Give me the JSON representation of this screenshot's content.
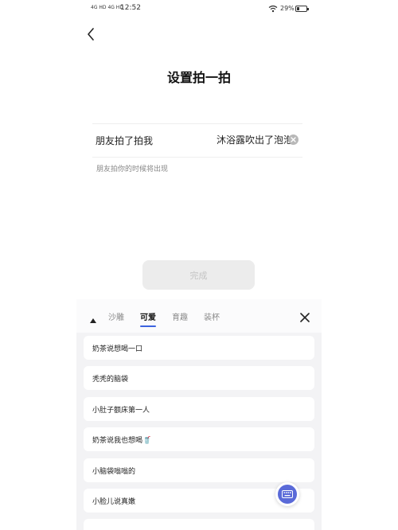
{
  "status_bar": {
    "signal_1": "4G HD",
    "signal_2": "4G HD",
    "time": "12:52",
    "battery_text": "29%",
    "battery_level": 0.29,
    "wifi_icon": "wifi-icon",
    "battery_icon": "battery-icon"
  },
  "nav": {
    "back_icon": "chevron-left-icon"
  },
  "page": {
    "title": "设置拍一拍",
    "field_label": "朋友拍了拍我",
    "field_value": "沐浴露吹出了泡泡",
    "hint": "朋友拍你的时候将出现",
    "done_label": "完成"
  },
  "sheet": {
    "tabs": [
      {
        "label": "沙雕",
        "active": false
      },
      {
        "label": "可爱",
        "active": true
      },
      {
        "label": "育趣",
        "active": false
      },
      {
        "label": "装杯",
        "active": false
      }
    ],
    "accent_color": "#3c63e0",
    "phrases": [
      "奶茶说想喝一口",
      "秃秃的脑袋",
      "小肚子额床第一人",
      "奶茶说我也想喝🥤",
      "小脑袋嗡嗡的",
      "小脸儿说真嫩"
    ]
  }
}
